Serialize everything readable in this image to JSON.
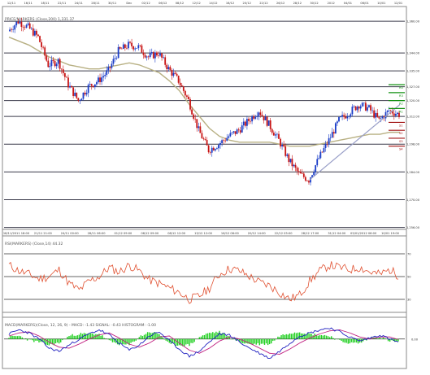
{
  "top_dates": [
    "12/11",
    "16/11",
    "18/11",
    "22/11",
    "24/11",
    "28/11",
    "30/11",
    "Dec",
    "02/12",
    "06/12",
    "08/12",
    "12/12",
    "14/12",
    "16/12",
    "20/12",
    "22/12",
    "26/12",
    "28/12",
    "30/12",
    "2012",
    "04/01",
    "06/01",
    "10/01",
    "12/01"
  ],
  "bottom_dates": [
    "18/11/2011 18:00",
    "21/11 21:00",
    "24/11 00:00",
    "28/11 06:00",
    "01/12 09:00",
    "06/12 09:00",
    "08/12 12:00",
    "13/12 12:00",
    "16/12 06:00",
    "20/12 14:00",
    "22/12 03:00",
    "28/12 17:00",
    "31/12 04:00",
    "05/01/2012 06:00",
    "10/01 19:00"
  ],
  "panels": {
    "price": {
      "header": "PRICE/MARKERS (Close,200) 1,331.37",
      "right_ticks": [
        "1,360.00",
        "1,344.00",
        "1,335.00",
        "1,320.00",
        "1,327.00",
        "1,312.00",
        "1,298.00",
        "1,284.00",
        "1,270.00",
        "1,256.00"
      ],
      "levels": [
        "R4",
        "R3",
        "R2",
        "R1",
        "S1",
        "S2",
        "S3",
        "S4"
      ]
    },
    "rsi": {
      "header": "RSI(MARKERS) (Close,14) 44.32",
      "right_ticks": [
        "70",
        "50",
        "30"
      ]
    },
    "macd": {
      "header": "MACD(MARKERS)(Close, 12, 26, 9) - MACD: -1.43  SIGNAL: -0.43  HISTOGRAM: -1.00",
      "right_ticks": [
        "0.00"
      ]
    }
  },
  "colors": {
    "candle_up": "#1a3cc8",
    "candle_down": "#c81414",
    "moving_average": "#b8b083",
    "level_line": "#3a3a4a",
    "rsi_line": "#e05030",
    "macd_line": "#2020c0",
    "signal_line": "#c02080",
    "histogram": "#20d020",
    "resistance_marker": "#109010",
    "support_marker": "#a01010",
    "trend_line": "#9aa0c8"
  },
  "chart_data": [
    {
      "type": "candlestick",
      "panel": "price",
      "title": "",
      "x_labels": [
        "18/11/2011 18:00",
        "21/11 21:00",
        "24/11 00:00",
        "28/11 06:00",
        "01/12 09:00",
        "06/12 09:00",
        "08/12 12:00",
        "13/12 12:00",
        "16/12 06:00",
        "20/12 14:00",
        "22/12 03:00",
        "28/12 17:00",
        "31/12 04:00",
        "05/01/2012 06:00",
        "10/01 19:00"
      ],
      "close_path": [
        1355,
        1360,
        1357,
        1352,
        1338,
        1340,
        1328,
        1320,
        1327,
        1330,
        1335,
        1345,
        1348,
        1347,
        1342,
        1344,
        1336,
        1330,
        1320,
        1305,
        1295,
        1298,
        1302,
        1305,
        1310,
        1315,
        1308,
        1300,
        1290,
        1283,
        1280,
        1291,
        1300,
        1310,
        1314,
        1318,
        1316,
        1310,
        1315,
        1313
      ],
      "moving_average_path": [
        1352,
        1350,
        1348,
        1345,
        1342,
        1340,
        1338,
        1337,
        1336,
        1336,
        1337,
        1338,
        1339,
        1338,
        1336,
        1334,
        1330,
        1325,
        1318,
        1312,
        1306,
        1302,
        1300,
        1299,
        1299,
        1299,
        1299,
        1298,
        1297,
        1297,
        1297,
        1298,
        1299,
        1300,
        1301,
        1302,
        1303,
        1303,
        1304,
        1304
      ],
      "levels": [
        {
          "name": "R4",
          "value": 1328
        },
        {
          "name": "R3",
          "value": 1324
        },
        {
          "name": "R2",
          "value": 1320
        },
        {
          "name": "R1",
          "value": 1316
        },
        {
          "name": "S1",
          "value": 1309
        },
        {
          "name": "S2",
          "value": 1305
        },
        {
          "name": "S3",
          "value": 1301
        },
        {
          "name": "S4",
          "value": 1297
        }
      ],
      "ylim": [
        1255,
        1365
      ]
    },
    {
      "type": "line",
      "panel": "rsi",
      "series": [
        {
          "values": [
            60,
            55,
            52,
            48,
            50,
            56,
            44,
            38,
            46,
            50,
            58,
            54,
            60,
            55,
            47,
            44,
            40,
            36,
            30,
            33,
            40,
            52,
            57,
            55,
            50,
            45,
            42,
            36,
            30,
            34,
            46,
            55,
            60,
            58,
            56,
            58,
            54,
            52,
            56,
            50
          ]
        }
      ],
      "ylim": [
        20,
        80
      ]
    },
    {
      "type": "line",
      "panel": "macd",
      "series": [
        {
          "values": [
            0.5,
            0.9,
            0.6,
            0.0,
            -0.9,
            -1.2,
            -0.6,
            0.0,
            0.5,
            0.9,
            0.4,
            -0.4,
            -1.1,
            -0.6,
            0.3,
            0.7,
            -0.2,
            -1.0,
            -1.7,
            -1.2,
            -0.3,
            0.5,
            0.4,
            -0.3,
            -0.9,
            -1.4,
            -1.9,
            -1.2,
            -0.4,
            0.3,
            0.6,
            0.9,
            1.1,
            0.7,
            0.2,
            -0.2,
            0.1,
            0.4,
            0.0,
            -0.4
          ]
        },
        {
          "values": [
            0.3,
            0.6,
            0.7,
            0.3,
            -0.3,
            -0.8,
            -0.9,
            -0.5,
            0.0,
            0.4,
            0.6,
            0.1,
            -0.5,
            -0.8,
            -0.4,
            0.2,
            0.3,
            -0.4,
            -1.1,
            -1.4,
            -0.9,
            -0.2,
            0.2,
            0.0,
            -0.4,
            -0.9,
            -1.4,
            -1.5,
            -1.0,
            -0.4,
            0.1,
            0.5,
            0.8,
            0.9,
            0.6,
            0.2,
            0.0,
            0.2,
            0.2,
            -0.1
          ]
        }
      ],
      "ylim": [
        -2.5,
        1.5
      ]
    }
  ]
}
